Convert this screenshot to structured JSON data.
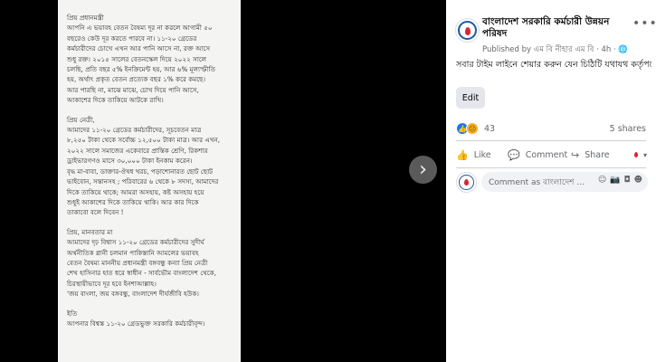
{
  "letter": {
    "paragraphs": [
      [
        "প্রিয় প্রধানমন্ত্রী",
        "আপনি এ ভয়াবহ বেতন বৈষম্য দূর না করলে আগামী ৫০",
        "বছরেও কেউ দূর করতে পারবে না। ১১-২০ গ্রেডের",
        "কর্মচারীদের চোখে এখন আর পানি আসে না, রক্ত আসে",
        "শুধু রক্ত। ২০১৫ সালের বেতনস্কেল দিয়ে ২০২২ সালে",
        "চলছি, প্রতি বছর ৫% ইনক্রিমেন্ট হয়, আর ৬% মূল্যস্ফীতি",
        "হয়, অর্থাৎ প্রকৃত বেতন প্রত্যেক বছর ১% করে কমছে।",
        "আর পারছি না,  মাঝে মাঝে, চোখ দিয়ে পানি আসে,",
        "আকাশের দিকে তাকিয়ে আটকে রাখি।"
      ],
      [
        "প্রিয় নেত্রী,",
        "আমাদের ১১-২০ গ্রেডের কর্মচারীদের, সূচবেতন মাত্র",
        "৮,২৫০ টাকা থেকে সর্বোচ্চ ১২,৫০০ টাকা মাত্র। আর এখন,",
        "২০২২ সালে সমাজের একেবারে প্রান্তিক শ্রেণি, রিকশার",
        "ড্রাইভারগণও মাসে ৩০,০০০ টাকা ইনকাম করেন।",
        "বৃদ্ধ মা-বাবা, ডাক্তার-ঔষধ খরচ, পড়াশোনারত ছোট ছোট",
        "ভাইবোন, সন্তানসহ ; পরিবারের ৬ থেকে ৮ সদস্য, আমাদের",
        "দিকে তাকিয়ে থাকে; আমরা অসহায়, কষ্ট অসহায় হয়ে",
        "শুধুই আকাশের দিকে তাকিয়ে থাকি। আর কার দিকে",
        "তাকাবো বলে দিবেন !"
      ],
      [
        "প্রিয়, মানবতার মা",
        "আমাদের দৃঢ় বিশ্বাস ১১-২০ গ্রেডের কর্মচারীদের সুদীর্ঘ",
        "অর্থনীতিক গ্লানী চলমান পাকিস্তানি আমলের ভয়াবহ",
        "বেতন বৈষম্য মাননীয় প্রধানমন্ত্রী বঙ্গবন্ধু কন্যা প্রিয় নেত্রী",
        "শেখ হাসিনার হাত ধরে স্বাধীন - সার্বভৌম বাংলাদেশ থেকে,",
        "চিরস্থায়ীভাবে দূর হবে ইনশাআল্লাহ।",
        "'জয় বাংলা, জয় বঙ্গবন্ধু, বাংলাদেশ দীর্ঘজীবি হউক।"
      ],
      [
        "ইতি",
        "আপনার বিশ্বস্ত ১১-২০ গ্রেডভুক্ত সরকারি কর্মচারীবৃন্দ।"
      ]
    ]
  },
  "viewer": {
    "next_icon": "chevron-right-icon"
  },
  "post": {
    "page_name": "বাংলাদেশ সরকারি কর্মচারী উন্নয়ন পরিষদ",
    "meta": "Published by এম বি নীহার এম বি · 4h · ",
    "post_text": "সবার টাইম লাইনে শেয়ার করুন যেন চিঠিটি যথাযথ কর্তৃপক্ষের দৃষ্টি আকর্ষণ করে, অগ্রিম ধন্যবাদ সকল কে..✌️",
    "edit_label": "Edit",
    "reaction_count": "43",
    "shares": "5 shares",
    "actions": {
      "like": "Like",
      "comment": "Comment",
      "share": "Share"
    },
    "comment_placeholder": "Comment as বাংলাদেশ ..."
  },
  "colors": {
    "accent": "#1877f2",
    "brand_red": "#d8262d",
    "brand_blue": "#1c5aa3"
  }
}
